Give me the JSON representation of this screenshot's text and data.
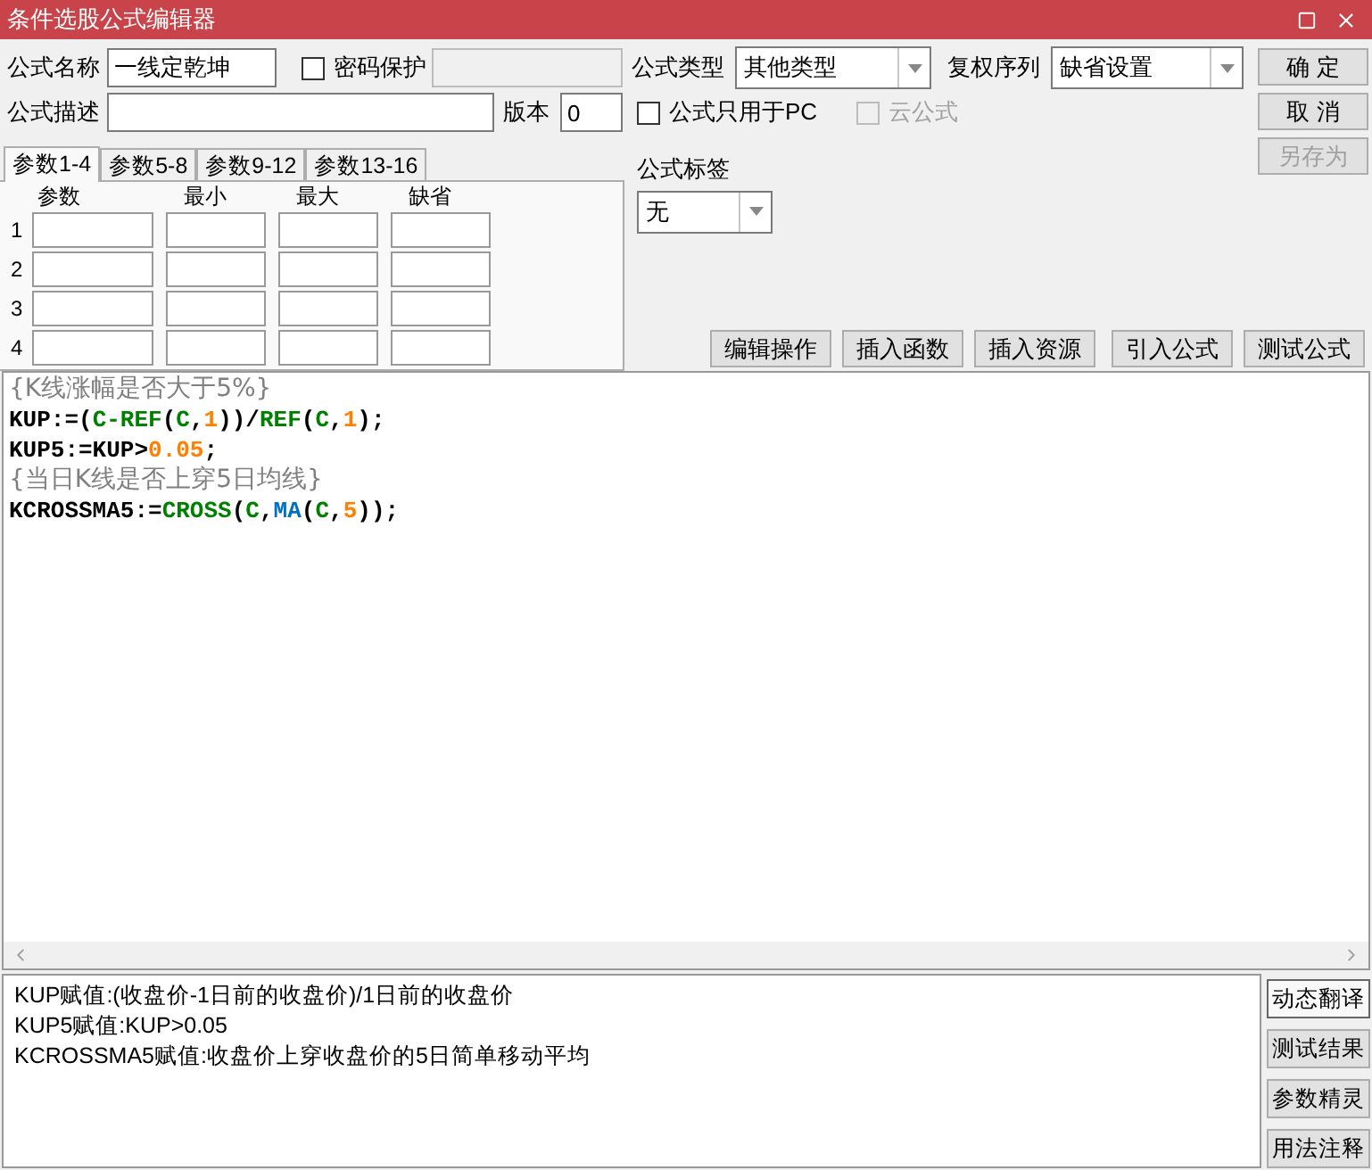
{
  "window": {
    "title": "条件选股公式编辑器"
  },
  "name_field": {
    "label": "公式名称",
    "value": "一线定乾坤"
  },
  "password": {
    "label": "密码保护",
    "checked": false
  },
  "description_field": {
    "label": "公式描述"
  },
  "version_field": {
    "label": "版本",
    "value": "0"
  },
  "formula_type": {
    "label": "公式类型",
    "value": "其他类型"
  },
  "rights_order": {
    "label": "复权序列",
    "value": "缺省设置"
  },
  "pc_only": {
    "label": "公式只用于PC",
    "checked": false,
    "disabled": false
  },
  "cloud": {
    "label": "云公式",
    "checked": false,
    "disabled": true
  },
  "tag": {
    "label": "公式标签",
    "value": "无"
  },
  "side_buttons": [
    {
      "label": "确 定",
      "disabled": false
    },
    {
      "label": "取 消",
      "disabled": false
    },
    {
      "label": "另存为",
      "disabled": true
    }
  ],
  "param_tabs": [
    {
      "label": "参数1-4",
      "selected": true
    },
    {
      "label": "参数5-8",
      "selected": false
    },
    {
      "label": "参数9-12",
      "selected": false
    },
    {
      "label": "参数13-16",
      "selected": false
    }
  ],
  "param_columns": [
    "参数",
    "最小",
    "最大",
    "缺省"
  ],
  "param_rows": [
    "1",
    "2",
    "3",
    "4"
  ],
  "action_buttons": [
    "编辑操作",
    "插入函数",
    "插入资源",
    "引入公式",
    "测试公式"
  ],
  "code_lines": [
    {
      "tokens": [
        {
          "kind": "comment",
          "text": "{K线涨幅是否大于5%}"
        }
      ]
    },
    {
      "tokens": [
        {
          "kind": "plain",
          "text": "KUP:=("
        },
        {
          "kind": "func",
          "text": "C-REF"
        },
        {
          "kind": "plain",
          "text": "("
        },
        {
          "kind": "func",
          "text": "C"
        },
        {
          "kind": "plain",
          "text": ","
        },
        {
          "kind": "num",
          "text": "1"
        },
        {
          "kind": "plain",
          "text": "))/"
        },
        {
          "kind": "func",
          "text": "REF"
        },
        {
          "kind": "plain",
          "text": "("
        },
        {
          "kind": "func",
          "text": "C"
        },
        {
          "kind": "plain",
          "text": ","
        },
        {
          "kind": "num",
          "text": "1"
        },
        {
          "kind": "plain",
          "text": ");"
        }
      ]
    },
    {
      "tokens": [
        {
          "kind": "plain",
          "text": "KUP5:=KUP>"
        },
        {
          "kind": "num",
          "text": "0.05"
        },
        {
          "kind": "plain",
          "text": ";"
        }
      ]
    },
    {
      "tokens": [
        {
          "kind": "comment",
          "text": "{当日K线是否上穿5日均线}"
        }
      ]
    },
    {
      "tokens": [
        {
          "kind": "plain",
          "text": "KCROSSMA5:="
        },
        {
          "kind": "func",
          "text": "CROSS"
        },
        {
          "kind": "plain",
          "text": "("
        },
        {
          "kind": "func",
          "text": "C"
        },
        {
          "kind": "plain",
          "text": ","
        },
        {
          "kind": "index",
          "text": "MA"
        },
        {
          "kind": "plain",
          "text": "("
        },
        {
          "kind": "func",
          "text": "C"
        },
        {
          "kind": "plain",
          "text": ","
        },
        {
          "kind": "num",
          "text": "5"
        },
        {
          "kind": "plain",
          "text": "));"
        }
      ]
    }
  ],
  "translation_lines": [
    "KUP赋值:(收盘价-1日前的收盘价)/1日前的收盘价",
    "KUP5赋值:KUP>0.05",
    "KCROSSMA5赋值:收盘价上穿收盘价的5日简单移动平均"
  ],
  "bottom_buttons": [
    {
      "label": "动态翻译",
      "selected": true
    },
    {
      "label": "测试结果",
      "selected": false
    },
    {
      "label": "参数精灵",
      "selected": false
    },
    {
      "label": "用法注释",
      "selected": false
    }
  ]
}
